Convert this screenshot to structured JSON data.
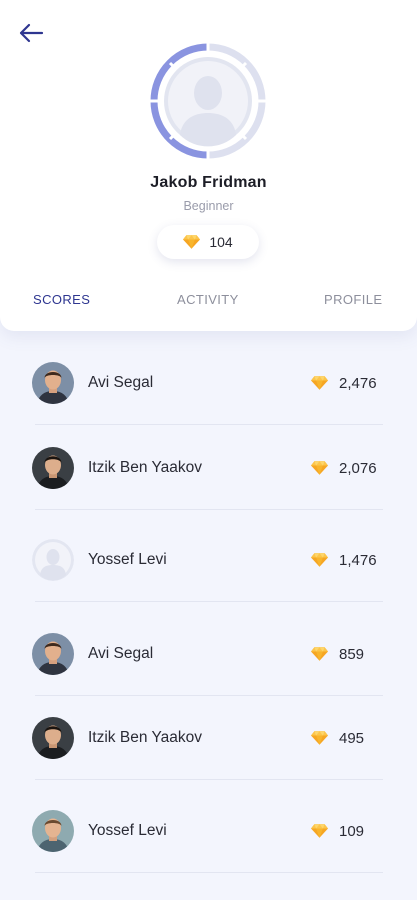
{
  "header": {
    "back_icon": "arrow-left-icon",
    "user": {
      "name": "Jakob Fridman",
      "level": "Beginner",
      "gems": "104"
    }
  },
  "tabs": [
    {
      "label": "SCORES",
      "active": true
    },
    {
      "label": "ACTIVITY",
      "active": false
    },
    {
      "label": "PROFILE",
      "active": false
    }
  ],
  "leaderboard": [
    {
      "name": "Avi Segal",
      "score": "2,476",
      "avatar": "photo"
    },
    {
      "name": "Itzik Ben Yaakov",
      "score": "2,076",
      "avatar": "photo"
    },
    {
      "name": "Yossef Levi",
      "score": "1,476",
      "avatar": "placeholder"
    },
    {
      "name": "Avi Segal",
      "score": "859",
      "avatar": "photo"
    },
    {
      "name": "Itzik Ben Yaakov",
      "score": "495",
      "avatar": "photo"
    },
    {
      "name": "Yossef Levi",
      "score": "109",
      "avatar": "photo"
    }
  ],
  "colors": {
    "accent": "#2e3690",
    "gem": "#f6a623",
    "background": "#f3f5fd",
    "ring_active": "#8a94e0",
    "ring_inactive": "#dde0ef"
  },
  "icons": {
    "gem": "diamond-icon",
    "avatar_placeholder": "user-silhouette-icon"
  }
}
